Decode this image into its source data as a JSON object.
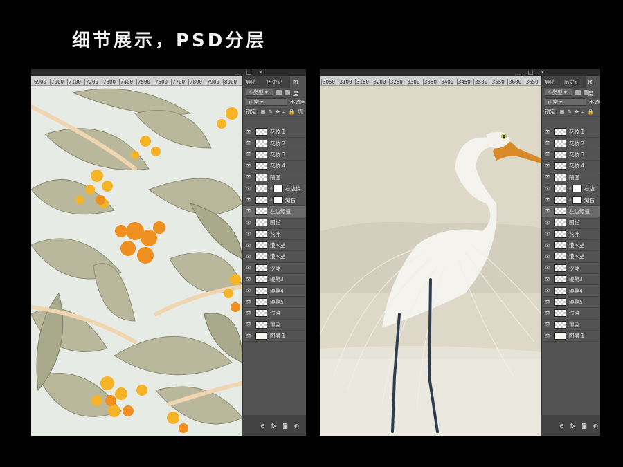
{
  "page": {
    "title": "细节展示，PSD分层"
  },
  "left": {
    "ruler": [
      "6900",
      "7000",
      "7100",
      "7200",
      "7300",
      "7400",
      "7500",
      "7600",
      "7700",
      "7800",
      "7900",
      "8000"
    ],
    "tabs": [
      "导航器",
      "历史记录",
      "图层"
    ],
    "filter_kind": "类型",
    "blend_mode": "正常",
    "opacity_label": "不透明",
    "lock_label": "锁定:",
    "fill_label": "填",
    "layers": [
      {
        "name": "花枝 1",
        "thumb": "check"
      },
      {
        "name": "花枝 2",
        "thumb": "check"
      },
      {
        "name": "花枝 3",
        "thumb": "check"
      },
      {
        "name": "花枝 4",
        "thumb": "check"
      },
      {
        "name": "隔面",
        "thumb": "check"
      },
      {
        "name": "右边枝",
        "thumb": "check",
        "mask": true
      },
      {
        "name": "湖石",
        "thumb": "check",
        "mask": true
      },
      {
        "name": "左边绿植",
        "thumb": "check",
        "selected": true
      },
      {
        "name": "围栏",
        "thumb": "check"
      },
      {
        "name": "花叶",
        "thumb": "check"
      },
      {
        "name": "灌木丛",
        "thumb": "check"
      },
      {
        "name": "灌木丛",
        "thumb": "check"
      },
      {
        "name": "沙砾",
        "thumb": "check"
      },
      {
        "name": "辘鹭3",
        "thumb": "check"
      },
      {
        "name": "辘鹭4",
        "thumb": "check"
      },
      {
        "name": "辘鹭5",
        "thumb": "check"
      },
      {
        "name": "浅滩",
        "thumb": "check"
      },
      {
        "name": "渲染",
        "thumb": "check"
      },
      {
        "name": "图层 1",
        "thumb": "solid"
      }
    ]
  },
  "right": {
    "ruler": [
      "3050",
      "3100",
      "3150",
      "3200",
      "3250",
      "3300",
      "3350",
      "3400",
      "3450",
      "3500",
      "3550",
      "3600",
      "3650"
    ],
    "tabs": [
      "导航器",
      "历史记录",
      "图层"
    ],
    "filter_kind": "类型",
    "blend_mode": "正常",
    "opacity_label": "不透明",
    "lock_label": "锁定:",
    "layers": [
      {
        "name": "花枝 1",
        "thumb": "check"
      },
      {
        "name": "花枝 2",
        "thumb": "check"
      },
      {
        "name": "花枝 3",
        "thumb": "check"
      },
      {
        "name": "花枝 4",
        "thumb": "check"
      },
      {
        "name": "隔面",
        "thumb": "check"
      },
      {
        "name": "右边",
        "thumb": "check",
        "mask": true
      },
      {
        "name": "湖石",
        "thumb": "check",
        "mask": true
      },
      {
        "name": "左边绿植",
        "thumb": "check",
        "selected": true
      },
      {
        "name": "围栏",
        "thumb": "check"
      },
      {
        "name": "花叶",
        "thumb": "check"
      },
      {
        "name": "灌木丛",
        "thumb": "check"
      },
      {
        "name": "灌木丛",
        "thumb": "check"
      },
      {
        "name": "沙砾",
        "thumb": "check"
      },
      {
        "name": "辘鹭3",
        "thumb": "check"
      },
      {
        "name": "辘鹭4",
        "thumb": "check"
      },
      {
        "name": "辘鹭5",
        "thumb": "check"
      },
      {
        "name": "浅滩",
        "thumb": "check"
      },
      {
        "name": "渲染",
        "thumb": "check"
      },
      {
        "name": "图层 1",
        "thumb": "solid"
      }
    ]
  },
  "footer_icons": [
    "link-icon",
    "fx-icon",
    "mask-icon",
    "adjustment-icon"
  ],
  "colors": {
    "background": "#000000",
    "panel": "#535353",
    "leaf": "#b8b89a",
    "blossom": "#f0a020"
  }
}
